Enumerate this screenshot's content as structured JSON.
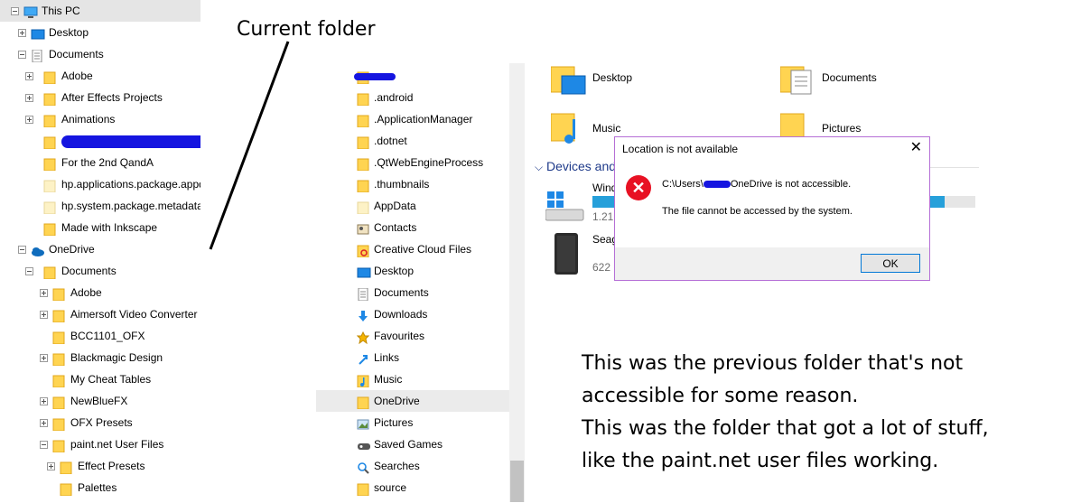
{
  "tree": {
    "items": [
      {
        "label": "This PC",
        "indent": 0,
        "expander": "minus",
        "icon": "computer-icon",
        "selected": true
      },
      {
        "label": "Desktop",
        "indent": 1,
        "expander": "plus",
        "icon": "desktop-icon"
      },
      {
        "label": "Documents",
        "indent": 1,
        "expander": "minus",
        "icon": "documents-icon"
      },
      {
        "label": "Adobe",
        "indent": 2,
        "expander": "plus",
        "icon": "folder-icon"
      },
      {
        "label": "After Effects Projects",
        "indent": 2,
        "expander": "plus",
        "icon": "folder-icon"
      },
      {
        "label": "Animations",
        "indent": 2,
        "expander": "plus",
        "icon": "folder-icon"
      },
      {
        "label": "",
        "indent": 2,
        "expander": "none",
        "icon": "folder-icon",
        "redacted": true
      },
      {
        "label": "For the 2nd QandA",
        "indent": 2,
        "expander": "none",
        "icon": "folder-icon"
      },
      {
        "label": "hp.applications.package.appdat",
        "indent": 2,
        "expander": "none",
        "icon": "folder-pale-icon"
      },
      {
        "label": "hp.system.package.metadata",
        "indent": 2,
        "expander": "none",
        "icon": "folder-pale-icon"
      },
      {
        "label": "Made with Inkscape",
        "indent": 2,
        "expander": "none",
        "icon": "folder-icon"
      },
      {
        "label": "OneDrive",
        "indent": 1,
        "expander": "minus",
        "icon": "onedrive-icon"
      },
      {
        "label": "Documents",
        "indent": 2,
        "expander": "minus",
        "icon": "folder-icon"
      },
      {
        "label": "Adobe",
        "indent": 3,
        "expander": "plus",
        "icon": "folder-icon"
      },
      {
        "label": "Aimersoft Video Converter U",
        "indent": 3,
        "expander": "plus",
        "icon": "folder-icon"
      },
      {
        "label": "BCC1101_OFX",
        "indent": 3,
        "expander": "none",
        "icon": "folder-icon"
      },
      {
        "label": "Blackmagic Design",
        "indent": 3,
        "expander": "plus",
        "icon": "folder-icon"
      },
      {
        "label": "My Cheat Tables",
        "indent": 3,
        "expander": "none",
        "icon": "folder-icon"
      },
      {
        "label": "NewBlueFX",
        "indent": 3,
        "expander": "plus",
        "icon": "folder-icon"
      },
      {
        "label": "OFX Presets",
        "indent": 3,
        "expander": "plus",
        "icon": "folder-icon"
      },
      {
        "label": "paint.net User Files",
        "indent": 3,
        "expander": "minus",
        "icon": "folder-icon"
      },
      {
        "label": "Effect Presets",
        "indent": 4,
        "expander": "plus",
        "icon": "folder-icon"
      },
      {
        "label": "Palettes",
        "indent": 4,
        "expander": "none",
        "icon": "folder-icon"
      }
    ]
  },
  "middle": {
    "items": [
      {
        "label": "",
        "icon": "folder-icon",
        "redacted": true
      },
      {
        "label": ".android",
        "icon": "folder-icon"
      },
      {
        "label": ".ApplicationManager",
        "icon": "folder-icon"
      },
      {
        "label": ".dotnet",
        "icon": "folder-icon"
      },
      {
        "label": ".QtWebEngineProcess",
        "icon": "folder-icon"
      },
      {
        "label": ".thumbnails",
        "icon": "folder-icon"
      },
      {
        "label": "AppData",
        "icon": "folder-pale-icon"
      },
      {
        "label": "Contacts",
        "icon": "contacts-icon"
      },
      {
        "label": "Creative Cloud Files",
        "icon": "creative-cloud-icon"
      },
      {
        "label": "Desktop",
        "icon": "desktop-icon"
      },
      {
        "label": "Documents",
        "icon": "documents-icon"
      },
      {
        "label": "Downloads",
        "icon": "downloads-icon"
      },
      {
        "label": "Favourites",
        "icon": "star-icon"
      },
      {
        "label": "Links",
        "icon": "links-icon"
      },
      {
        "label": "Music",
        "icon": "music-icon"
      },
      {
        "label": "OneDrive",
        "icon": "folder-icon",
        "selected": true
      },
      {
        "label": "Pictures",
        "icon": "pictures-icon"
      },
      {
        "label": "Saved Games",
        "icon": "saved-games-icon"
      },
      {
        "label": "Searches",
        "icon": "search-icon"
      },
      {
        "label": "source",
        "icon": "folder-icon"
      }
    ]
  },
  "right": {
    "folders": [
      {
        "label": "Desktop"
      },
      {
        "label": "Documents"
      },
      {
        "label": "Music"
      },
      {
        "label": "Pictures"
      }
    ],
    "devices_header": "Devices and",
    "devices": [
      {
        "name": "Wind",
        "size": "1.21",
        "fill": 0.92
      },
      {
        "name": "Seag",
        "size": "622"
      }
    ]
  },
  "dialog": {
    "title": "Location is not available",
    "close": "✕",
    "path_prefix": "C:\\Users\\",
    "path_suffix": "OneDrive is not accessible.",
    "message": "The file cannot be accessed by the system.",
    "ok": "OK"
  },
  "annotations": {
    "current_folder": "Current folder",
    "note_lines": [
      "This was the previous folder that's not",
      "accessible for some reason.",
      "This was the folder that got a lot of stuff,",
      "like the paint.net user files working."
    ]
  },
  "colors": {
    "accent": "#0078d7",
    "redaction": "#1515e0",
    "folder": "#ffd451",
    "dialog_border": "#b56fd6",
    "error": "#e81123"
  }
}
